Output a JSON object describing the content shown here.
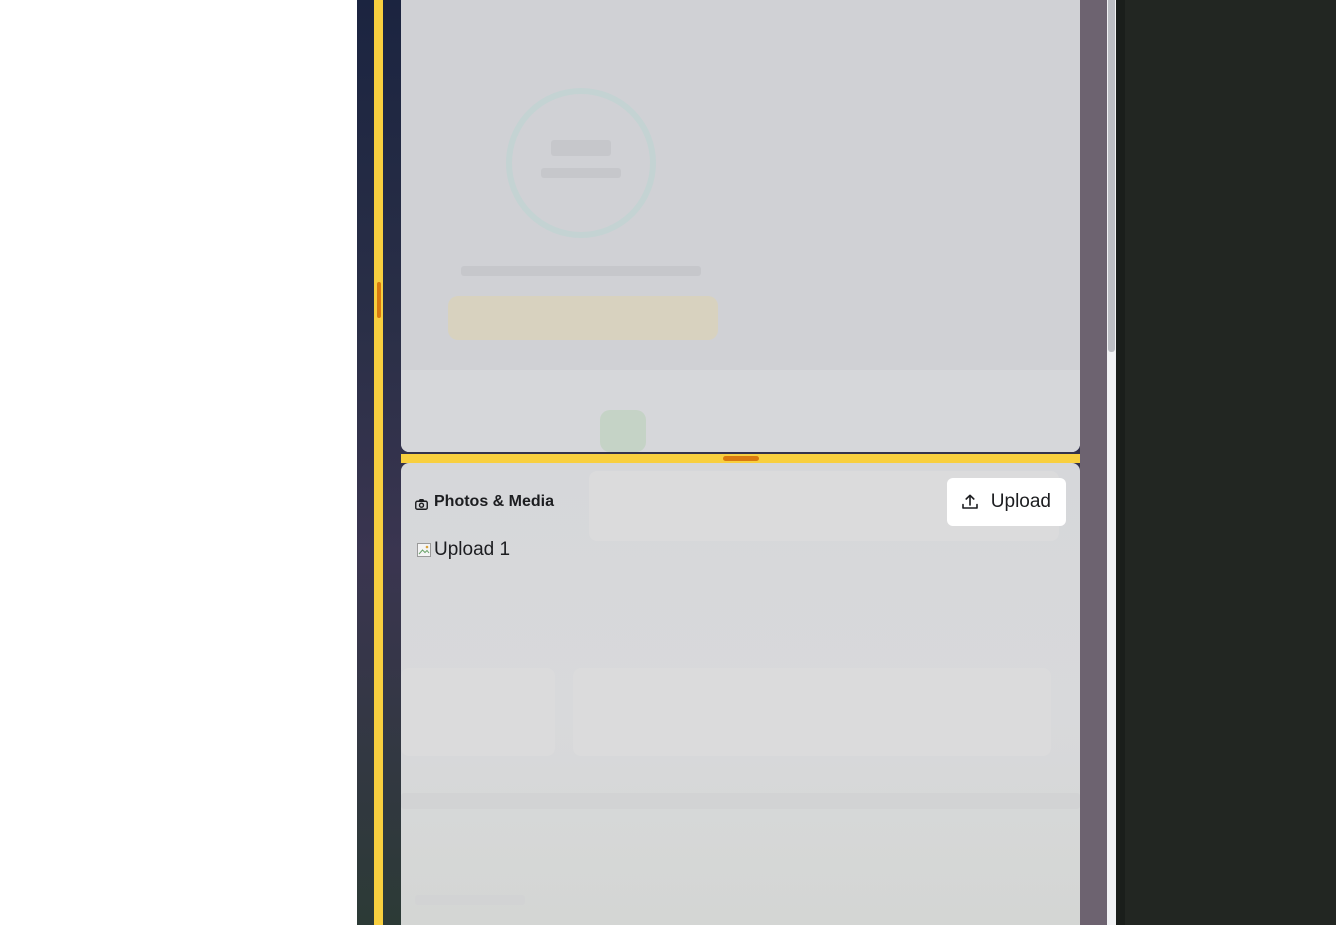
{
  "media": {
    "title": "Photos & Media",
    "upload_label": "Upload",
    "uploads": [
      {
        "alt": "Upload 1"
      }
    ]
  },
  "icons": {
    "title_icon": "camera-icon",
    "upload_icon": "upload-icon",
    "thumbnail_icon": "broken-image-icon"
  },
  "colors": {
    "accent_yellow": "#f8cf3f",
    "accent_orange": "#d97a0f",
    "sheet_gray": "#d6d7da",
    "right_panel": "#222622"
  }
}
